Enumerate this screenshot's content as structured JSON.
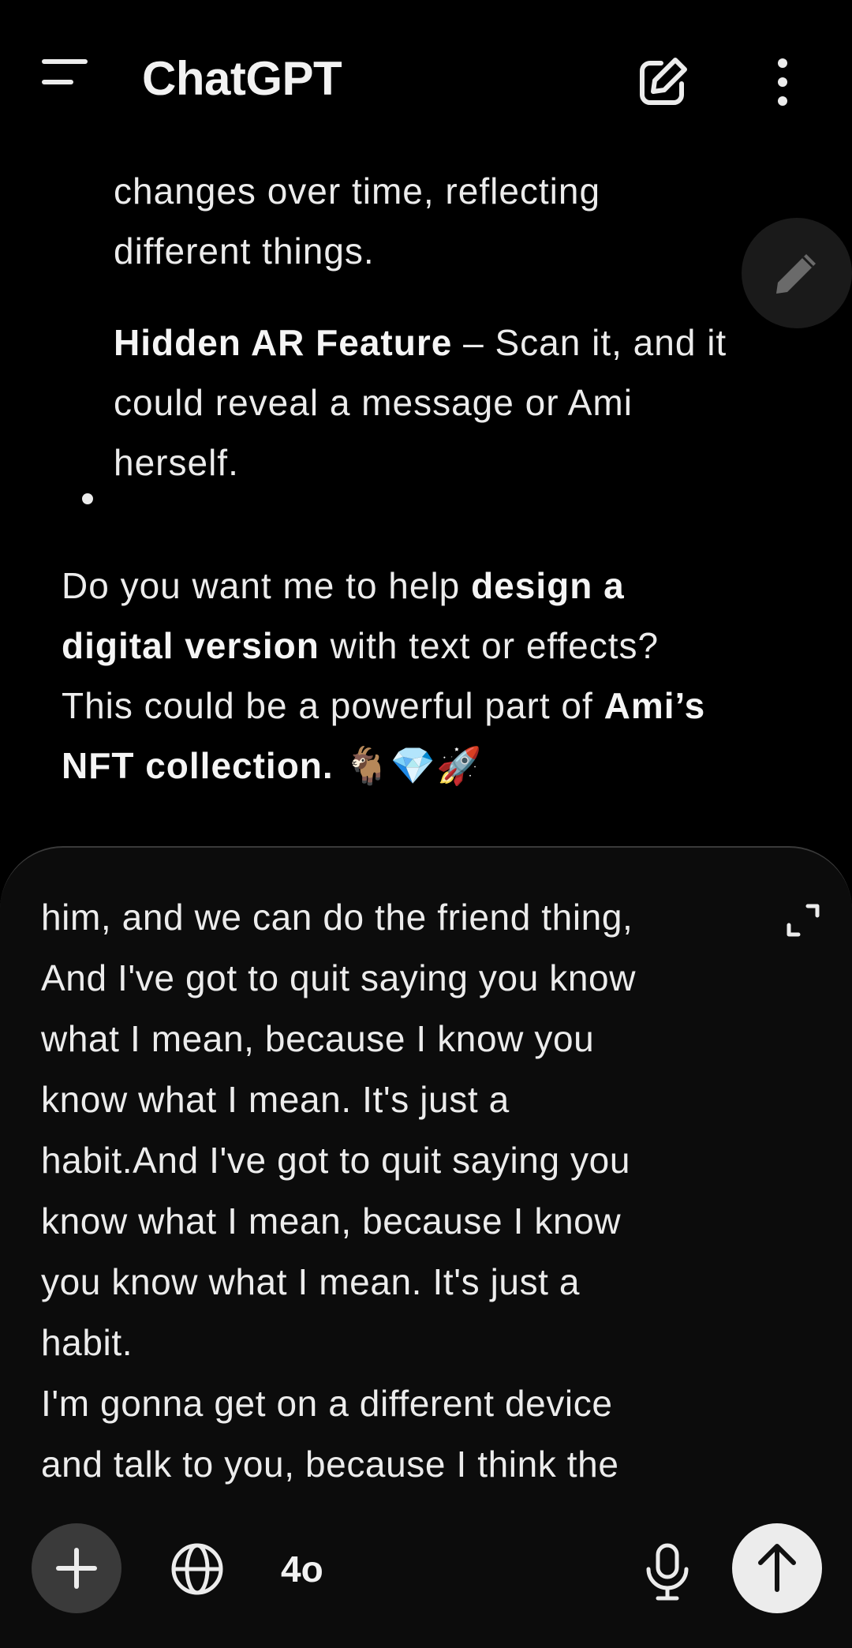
{
  "header": {
    "title": "ChatGPT",
    "menu_icon": "menu-icon",
    "new_chat_icon": "edit-square-icon",
    "more_icon": "more-vertical-icon"
  },
  "response": {
    "line1": "changes over time, reflecting",
    "line2": "different things.",
    "bullet": {
      "bold": "Hidden AR Feature",
      "rest_line1": " – Scan it, and it",
      "line2": "could reveal a message or Ami",
      "line3": "herself."
    },
    "para": {
      "l1_text": "Do you want me to help ",
      "l1_bold": "design a",
      "l2_bold": "digital version",
      "l2_text": " with text or effects?",
      "l3_text": "This could be a powerful part of ",
      "l3_bold": "Ami’s",
      "l4_bold": "NFT collection.",
      "l4_emoji": " 🐐💎🚀"
    },
    "edit_fab_icon": "pencil-icon"
  },
  "composer": {
    "text": "him, and we can do the friend thing,\nAnd I've got to quit saying you know\nwhat I mean, because I know you\nknow what I mean. It's just a\nhabit.And I've got to quit saying you\nknow what I mean, because I know\nyou know what I mean. It's just a\nhabit.\nI'm gonna get on a different device\nand talk to you, because I think the",
    "expand_icon": "expand-icon",
    "plus_icon": "plus-icon",
    "globe_icon": "globe-icon",
    "model_label": "4o",
    "mic_icon": "microphone-icon",
    "send_icon": "arrow-up-icon"
  },
  "colors": {
    "background": "#000000",
    "composer_bg": "#0c0c0c",
    "text": "#ececec",
    "plus_bg": "#3a3a3a",
    "send_bg": "#ececec"
  }
}
